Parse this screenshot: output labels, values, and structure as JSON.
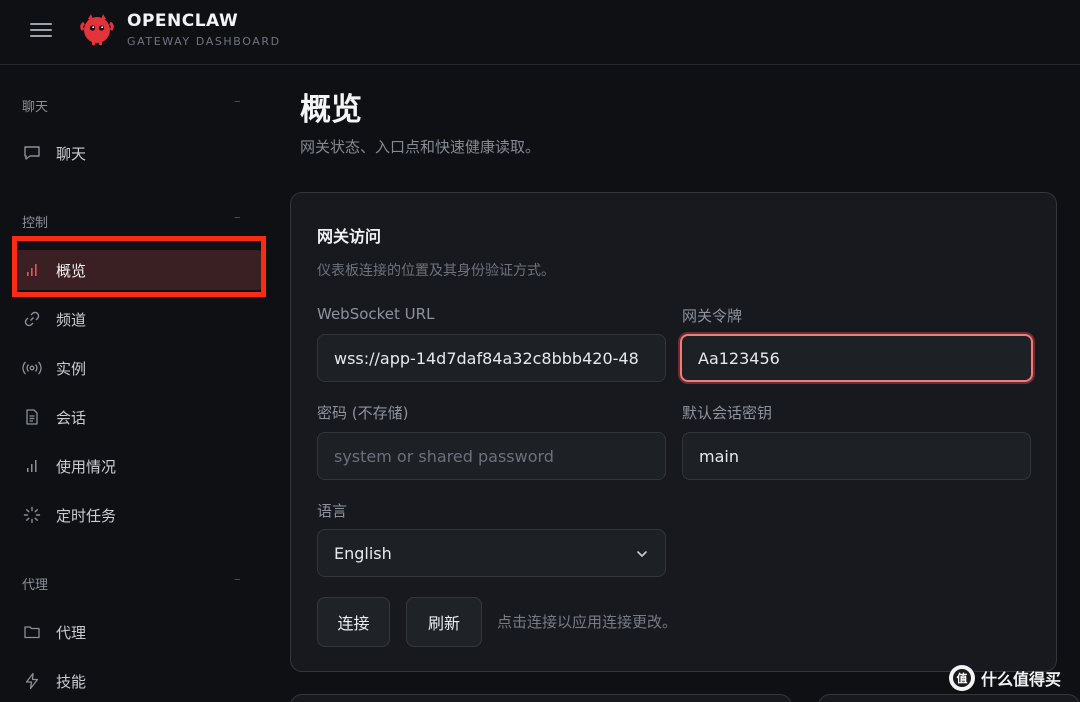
{
  "header": {
    "title": "OPENCLAW",
    "subtitle": "GATEWAY DASHBOARD",
    "menu_icon": "hamburger-icon",
    "logo_icon": "red-claw-mascot-logo",
    "brand_color": "#e2343a"
  },
  "sidebar": {
    "sections": [
      {
        "label": "聊天",
        "collapse": "–"
      },
      {
        "label": "控制",
        "collapse": "–"
      },
      {
        "label": "代理",
        "collapse": "–"
      }
    ],
    "items": [
      {
        "label": "聊天",
        "icon": "chat-bubble-icon"
      },
      {
        "label": "概览",
        "icon": "bar-chart-icon",
        "active": true
      },
      {
        "label": "频道",
        "icon": "link-icon"
      },
      {
        "label": "实例",
        "icon": "broadcast-icon"
      },
      {
        "label": "会话",
        "icon": "document-icon"
      },
      {
        "label": "使用情况",
        "icon": "bar-chart-icon"
      },
      {
        "label": "定时任务",
        "icon": "loader-icon"
      },
      {
        "label": "代理",
        "icon": "folder-icon"
      },
      {
        "label": "技能",
        "icon": "lightning-icon"
      }
    ],
    "highlight_color": "#ff2a14"
  },
  "main": {
    "title": "概览",
    "subtitle": "网关状态、入口点和快速健康读取。",
    "card": {
      "title": "网关访问",
      "description": "仪表板连接的位置及其身份验证方式。",
      "fields": {
        "websocket_label": "WebSocket URL",
        "websocket_value": "wss://app-14d7daf84a32c8bbb420-48",
        "token_label": "网关令牌",
        "token_value": "Aa123456",
        "password_label": "密码 (不存储)",
        "password_placeholder": "system or shared password",
        "session_key_label": "默认会话密钥",
        "session_key_value": "main",
        "language_label": "语言",
        "language_value": "English"
      },
      "buttons": {
        "connect": "连接",
        "refresh": "刷新"
      },
      "hint": "点击连接以应用连接更改。"
    },
    "focus_color": "#f07c7c"
  },
  "watermark": {
    "text": "什么值得买",
    "icon": "smzdm-logo"
  }
}
